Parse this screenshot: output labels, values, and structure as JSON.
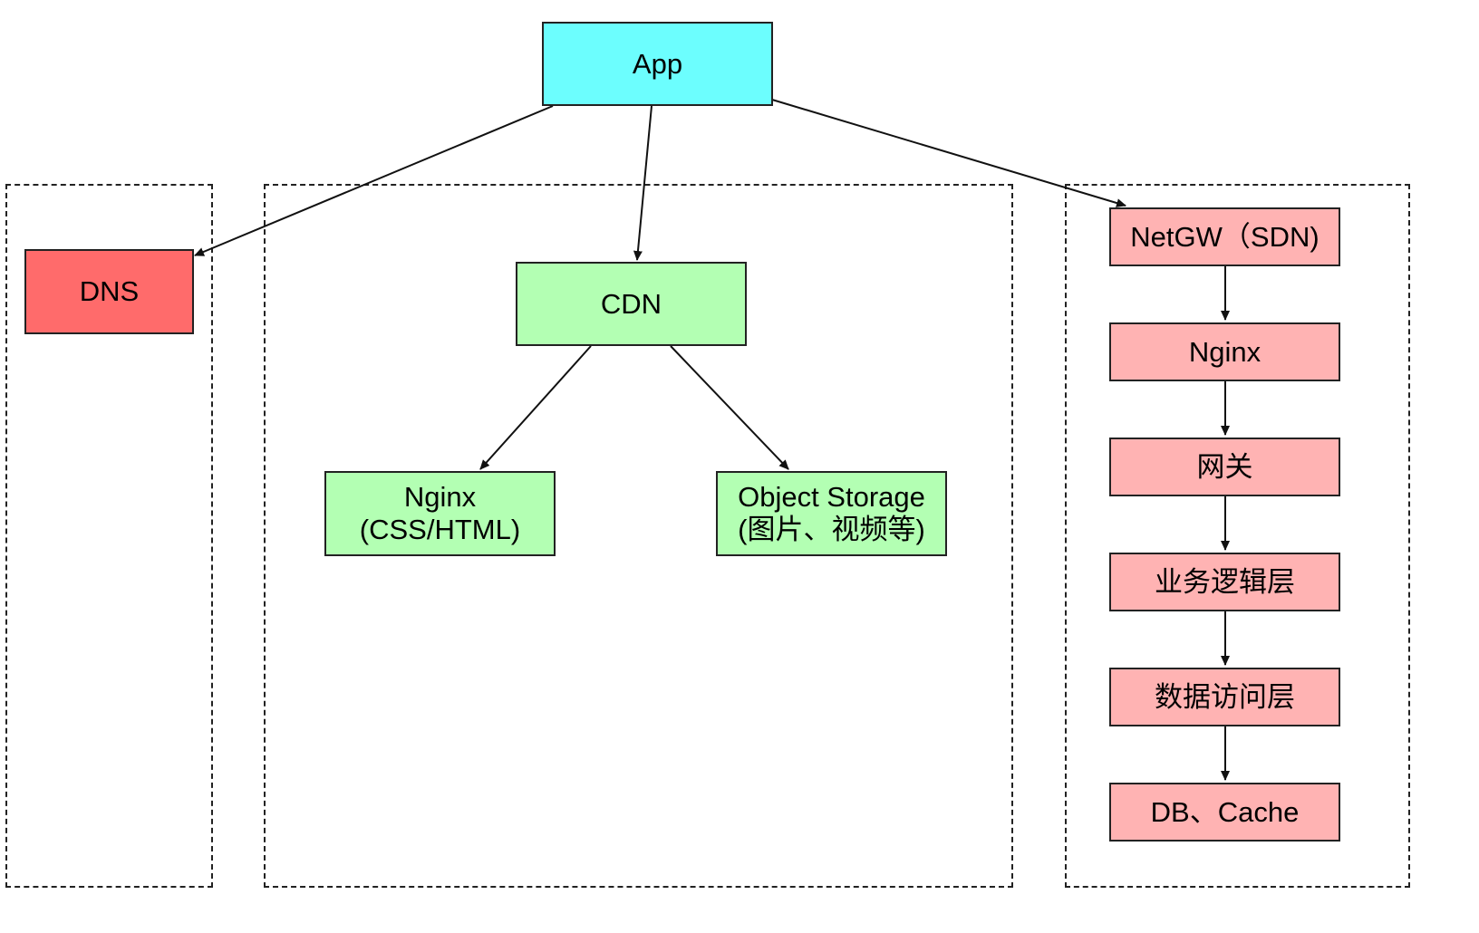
{
  "colors": {
    "app": "#6cfefe",
    "dns": "#ff6b6b",
    "cdn_group": "#b3ffb3",
    "backend_chain": "#ffb3b3",
    "border": "#222222",
    "edge": "#111111"
  },
  "nodes": {
    "app": "App",
    "dns": "DNS",
    "cdn": "CDN",
    "nginx_static_line1": "Nginx",
    "nginx_static_line2": "(CSS/HTML)",
    "object_storage_line1": "Object Storage",
    "object_storage_line2": "(图片、视频等)",
    "netgw": "NetGW（SDN)",
    "nginx": "Nginx",
    "gateway": "网关",
    "business_logic": "业务逻辑层",
    "data_access": "数据访问层",
    "db_cache": "DB、Cache"
  },
  "edges": [
    {
      "from": "app",
      "to": "dns"
    },
    {
      "from": "app",
      "to": "cdn"
    },
    {
      "from": "app",
      "to": "netgw"
    },
    {
      "from": "cdn",
      "to": "nginx_static"
    },
    {
      "from": "cdn",
      "to": "object_storage"
    },
    {
      "from": "netgw",
      "to": "nginx"
    },
    {
      "from": "nginx",
      "to": "gateway"
    },
    {
      "from": "gateway",
      "to": "business_logic"
    },
    {
      "from": "business_logic",
      "to": "data_access"
    },
    {
      "from": "data_access",
      "to": "db_cache"
    }
  ]
}
